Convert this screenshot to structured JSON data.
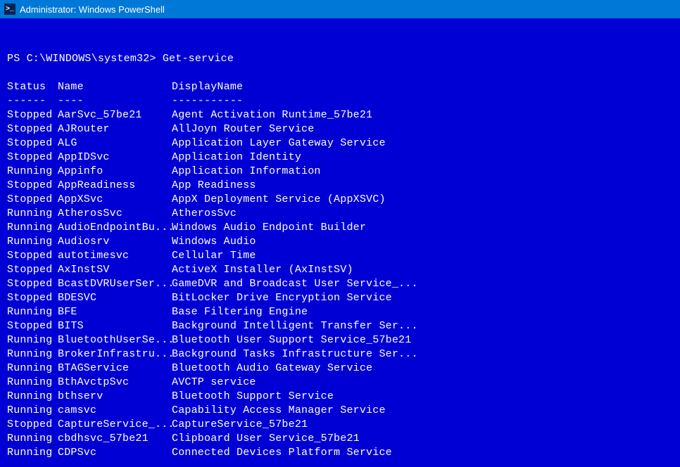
{
  "titlebar": {
    "icon": "powershell-icon",
    "title": "Administrator: Windows PowerShell"
  },
  "prompt": {
    "prefix": "PS C:\\WINDOWS\\system32> ",
    "command": "Get-service"
  },
  "headers": {
    "status": "Status",
    "name": "Name",
    "displayName": "DisplayName"
  },
  "dividers": {
    "status": "------",
    "name": "----",
    "displayName": "-----------"
  },
  "services": [
    {
      "status": "Stopped",
      "name": "AarSvc_57be21",
      "displayName": "Agent Activation Runtime_57be21"
    },
    {
      "status": "Stopped",
      "name": "AJRouter",
      "displayName": "AllJoyn Router Service"
    },
    {
      "status": "Stopped",
      "name": "ALG",
      "displayName": "Application Layer Gateway Service"
    },
    {
      "status": "Stopped",
      "name": "AppIDSvc",
      "displayName": "Application Identity"
    },
    {
      "status": "Running",
      "name": "Appinfo",
      "displayName": "Application Information"
    },
    {
      "status": "Stopped",
      "name": "AppReadiness",
      "displayName": "App Readiness"
    },
    {
      "status": "Stopped",
      "name": "AppXSvc",
      "displayName": "AppX Deployment Service (AppXSVC)"
    },
    {
      "status": "Running",
      "name": "AtherosSvc",
      "displayName": "AtherosSvc"
    },
    {
      "status": "Running",
      "name": "AudioEndpointBu...",
      "displayName": "Windows Audio Endpoint Builder"
    },
    {
      "status": "Running",
      "name": "Audiosrv",
      "displayName": "Windows Audio"
    },
    {
      "status": "Stopped",
      "name": "autotimesvc",
      "displayName": "Cellular Time"
    },
    {
      "status": "Stopped",
      "name": "AxInstSV",
      "displayName": "ActiveX Installer (AxInstSV)"
    },
    {
      "status": "Stopped",
      "name": "BcastDVRUserSer...",
      "displayName": "GameDVR and Broadcast User Service_..."
    },
    {
      "status": "Stopped",
      "name": "BDESVC",
      "displayName": "BitLocker Drive Encryption Service"
    },
    {
      "status": "Running",
      "name": "BFE",
      "displayName": "Base Filtering Engine"
    },
    {
      "status": "Stopped",
      "name": "BITS",
      "displayName": "Background Intelligent Transfer Ser..."
    },
    {
      "status": "Running",
      "name": "BluetoothUserSe...",
      "displayName": "Bluetooth User Support Service_57be21"
    },
    {
      "status": "Running",
      "name": "BrokerInfrastru...",
      "displayName": "Background Tasks Infrastructure Ser..."
    },
    {
      "status": "Running",
      "name": "BTAGService",
      "displayName": "Bluetooth Audio Gateway Service"
    },
    {
      "status": "Running",
      "name": "BthAvctpSvc",
      "displayName": "AVCTP service"
    },
    {
      "status": "Running",
      "name": "bthserv",
      "displayName": "Bluetooth Support Service"
    },
    {
      "status": "Running",
      "name": "camsvc",
      "displayName": "Capability Access Manager Service"
    },
    {
      "status": "Stopped",
      "name": "CaptureService_...",
      "displayName": "CaptureService_57be21"
    },
    {
      "status": "Running",
      "name": "cbdhsvc_57be21",
      "displayName": "Clipboard User Service_57be21"
    },
    {
      "status": "Running",
      "name": "CDPSvc",
      "displayName": "Connected Devices Platform Service"
    }
  ]
}
